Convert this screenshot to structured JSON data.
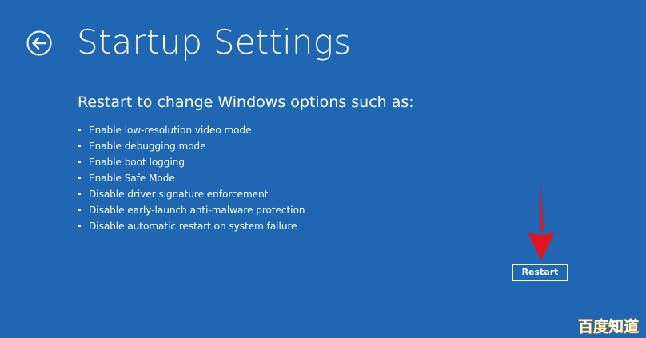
{
  "page": {
    "title": "Startup Settings",
    "subtitle": "Restart to change Windows options such as:"
  },
  "options": [
    "Enable low-resolution video mode",
    "Enable debugging mode",
    "Enable boot logging",
    "Enable Safe Mode",
    "Disable driver signature enforcement",
    "Disable early-launch anti-malware protection",
    "Disable automatic restart on system failure"
  ],
  "actions": {
    "restart_label": "Restart"
  },
  "icons": {
    "back": "back-arrow-icon",
    "annotation": "red-down-arrow"
  },
  "watermark": {
    "text": "百度知道"
  },
  "colors": {
    "background": "#1f66b3",
    "text": "#ffffff",
    "annotation_arrow": "#e8141c"
  }
}
